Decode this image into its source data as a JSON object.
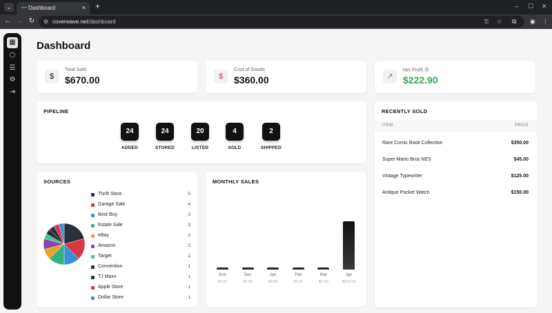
{
  "browser": {
    "tab_title": "Dashboard",
    "url_host": "coverwave.net",
    "url_path": "/dashboard"
  },
  "page": {
    "title": "Dashboard"
  },
  "stats": {
    "total_sold": {
      "label": "Total Sold",
      "value": "$670.00",
      "icon": "dollar-icon"
    },
    "cost_of_goods": {
      "label": "Cost of Goods",
      "value": "$360.00",
      "icon": "dollar-icon"
    },
    "net_profit": {
      "label": "Net Profit",
      "value": "$222.90",
      "icon": "trend-up-icon",
      "color": "#3aa35a"
    }
  },
  "pipeline": {
    "title": "PIPELINE",
    "stages": [
      {
        "label": "ADDED",
        "count": "24"
      },
      {
        "label": "STORED",
        "count": "24"
      },
      {
        "label": "LISTED",
        "count": "20"
      },
      {
        "label": "SOLD",
        "count": "4"
      },
      {
        "label": "SHIPPED",
        "count": "2"
      }
    ]
  },
  "recently_sold": {
    "title": "RECENTLY SOLD",
    "col_item": "ITEM",
    "col_price": "PRICE",
    "rows": [
      {
        "item": "Rare Comic Book Collection",
        "price": "$350.00"
      },
      {
        "item": "Super Mario Bros NES",
        "price": "$45.00"
      },
      {
        "item": "Vintage Typewriter",
        "price": "$125.00"
      },
      {
        "item": "Antique Pocket Watch",
        "price": "$150.00"
      }
    ]
  },
  "sources": {
    "title": "SOURCES",
    "items": [
      {
        "name": "Thrift Store",
        "count": "5",
        "color": "#2b2f3a"
      },
      {
        "name": "Garage Sale",
        "count": "4",
        "color": "#dc3545"
      },
      {
        "name": "Best Buy",
        "count": "3",
        "color": "#3b8fd6"
      },
      {
        "name": "Estate Sale",
        "count": "3",
        "color": "#35b37e"
      },
      {
        "name": "eBay",
        "count": "2",
        "color": "#f0a022"
      },
      {
        "name": "Amazon",
        "count": "2",
        "color": "#8e44ad"
      },
      {
        "name": "Target",
        "count": "1",
        "color": "#40c4a0"
      },
      {
        "name": "Convention",
        "count": "1",
        "color": "#2b2f3a"
      },
      {
        "name": "TJ Maxx",
        "count": "1",
        "color": "#2b2f3a"
      },
      {
        "name": "Apple Store",
        "count": "1",
        "color": "#dc3545"
      },
      {
        "name": "Dollar Store",
        "count": "1",
        "color": "#3b8fd6"
      }
    ]
  },
  "monthly_sales": {
    "title": "MONTHLY SALES",
    "chart_data": {
      "type": "bar",
      "categories": [
        "Nov",
        "Dec",
        "Jan",
        "Feb",
        "Mar",
        "Apr"
      ],
      "values": [
        0,
        0,
        0,
        0,
        0,
        670
      ],
      "value_labels": [
        "$0.00",
        "$0.00",
        "$0.00",
        "$0.00",
        "$0.00",
        "$670.00"
      ],
      "ylim": [
        0,
        670
      ]
    }
  }
}
